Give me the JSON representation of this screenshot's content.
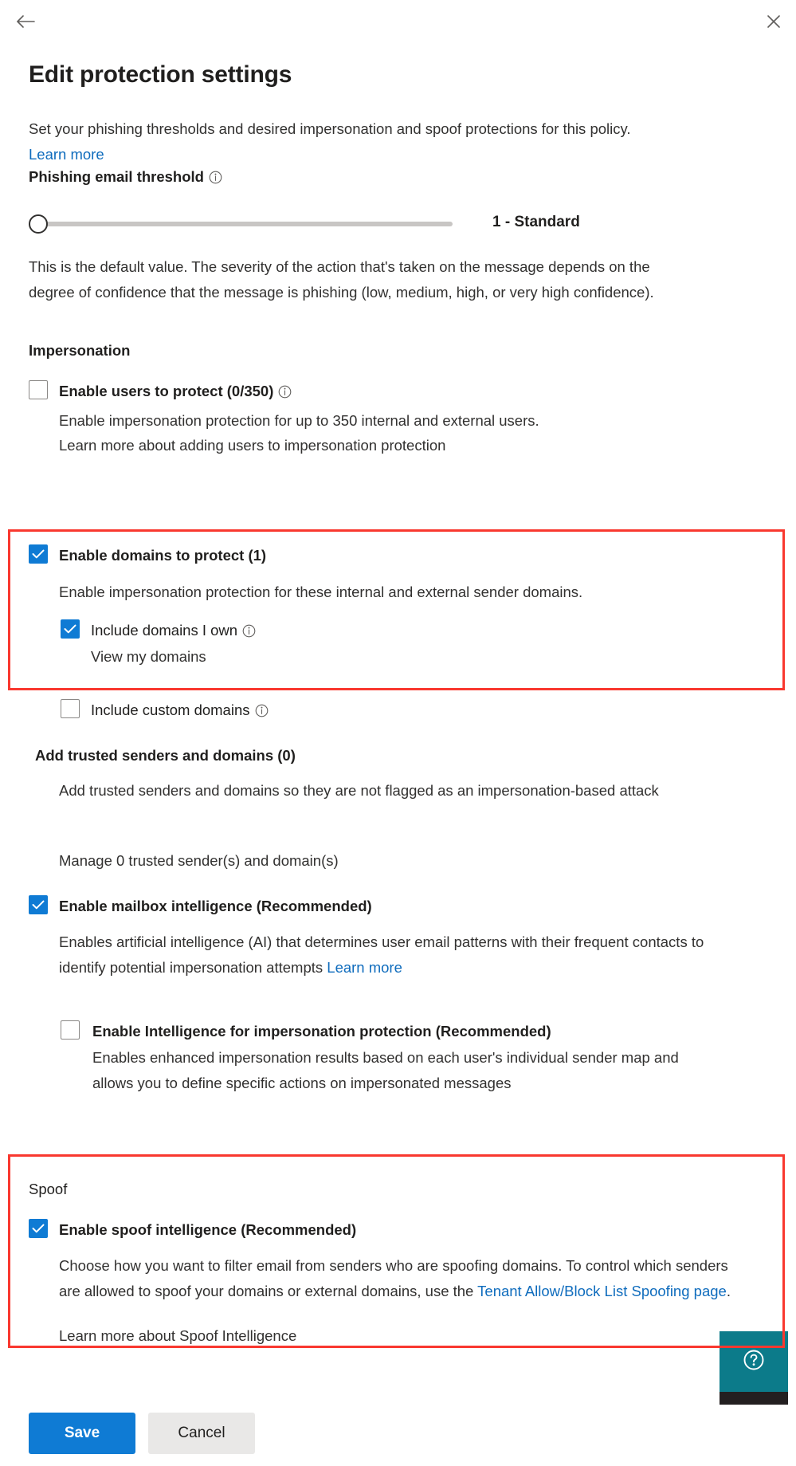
{
  "window": {
    "back_icon": "arrow-left-icon",
    "close_icon": "close-icon"
  },
  "header": {
    "title": "Edit protection settings",
    "description_prefix": "Set your phishing thresholds and desired impersonation and spoof protections for this policy. ",
    "description_link": "Learn more"
  },
  "threshold": {
    "label": "Phishing email threshold",
    "info_icon": "info-icon",
    "value_label": "1 - Standard",
    "value": 1,
    "min": 1,
    "max": 4,
    "description": "This is the default value. The severity of the action that's taken on the message depends on the degree of confidence that the message is phishing (low, medium, high, or very high confidence)."
  },
  "impersonation": {
    "section_title": "Impersonation",
    "users_to_protect": {
      "label": "Enable users to protect (0/350)",
      "checked": false,
      "info_icon": "info-icon",
      "description": "Enable impersonation protection for up to 350 internal and external users.",
      "link": "Learn more about adding users to impersonation protection"
    },
    "domains_to_protect": {
      "label": "Enable domains to protect (1)",
      "checked": true,
      "description": "Enable impersonation protection for these internal and external sender domains.",
      "include_owned": {
        "label": "Include domains I own",
        "checked": true,
        "info_icon": "info-icon",
        "link": "View my domains"
      },
      "include_custom": {
        "label": "Include custom domains",
        "checked": false,
        "info_icon": "info-icon"
      }
    },
    "trusted_senders": {
      "title": "Add trusted senders and domains (0)",
      "description": "Add trusted senders and domains so they are not flagged as an impersonation-based attack",
      "link": "Manage 0 trusted sender(s) and domain(s)"
    },
    "mailbox_intelligence": {
      "label": "Enable mailbox intelligence (Recommended)",
      "checked": true,
      "description_prefix": "Enables artificial intelligence (AI) that determines user email patterns with their frequent contacts to identify potential impersonation attempts ",
      "description_link": "Learn more",
      "sub": {
        "label": "Enable Intelligence for impersonation protection (Recommended)",
        "checked": false,
        "description": "Enables enhanced impersonation results based on each user's individual sender map and allows you to define specific actions on impersonated messages"
      }
    }
  },
  "spoof": {
    "section_title": "Spoof",
    "spoof_intelligence": {
      "label": "Enable spoof intelligence (Recommended)",
      "checked": true,
      "description_part1": "Choose how you want to filter email from senders who are spoofing domains. To control which senders are allowed to spoof your domains or external domains, use the ",
      "description_link": "Tenant Allow/Block List Spoofing page",
      "description_part2": ".",
      "learn_more_link": "Learn more about Spoof Intelligence"
    }
  },
  "help_widget": {
    "icon": "question-circle-icon",
    "accent_color": "#0c7b8a"
  },
  "footer": {
    "save_label": "Save",
    "cancel_label": "Cancel"
  },
  "highlights": {
    "accent_color": "#f9382f"
  }
}
